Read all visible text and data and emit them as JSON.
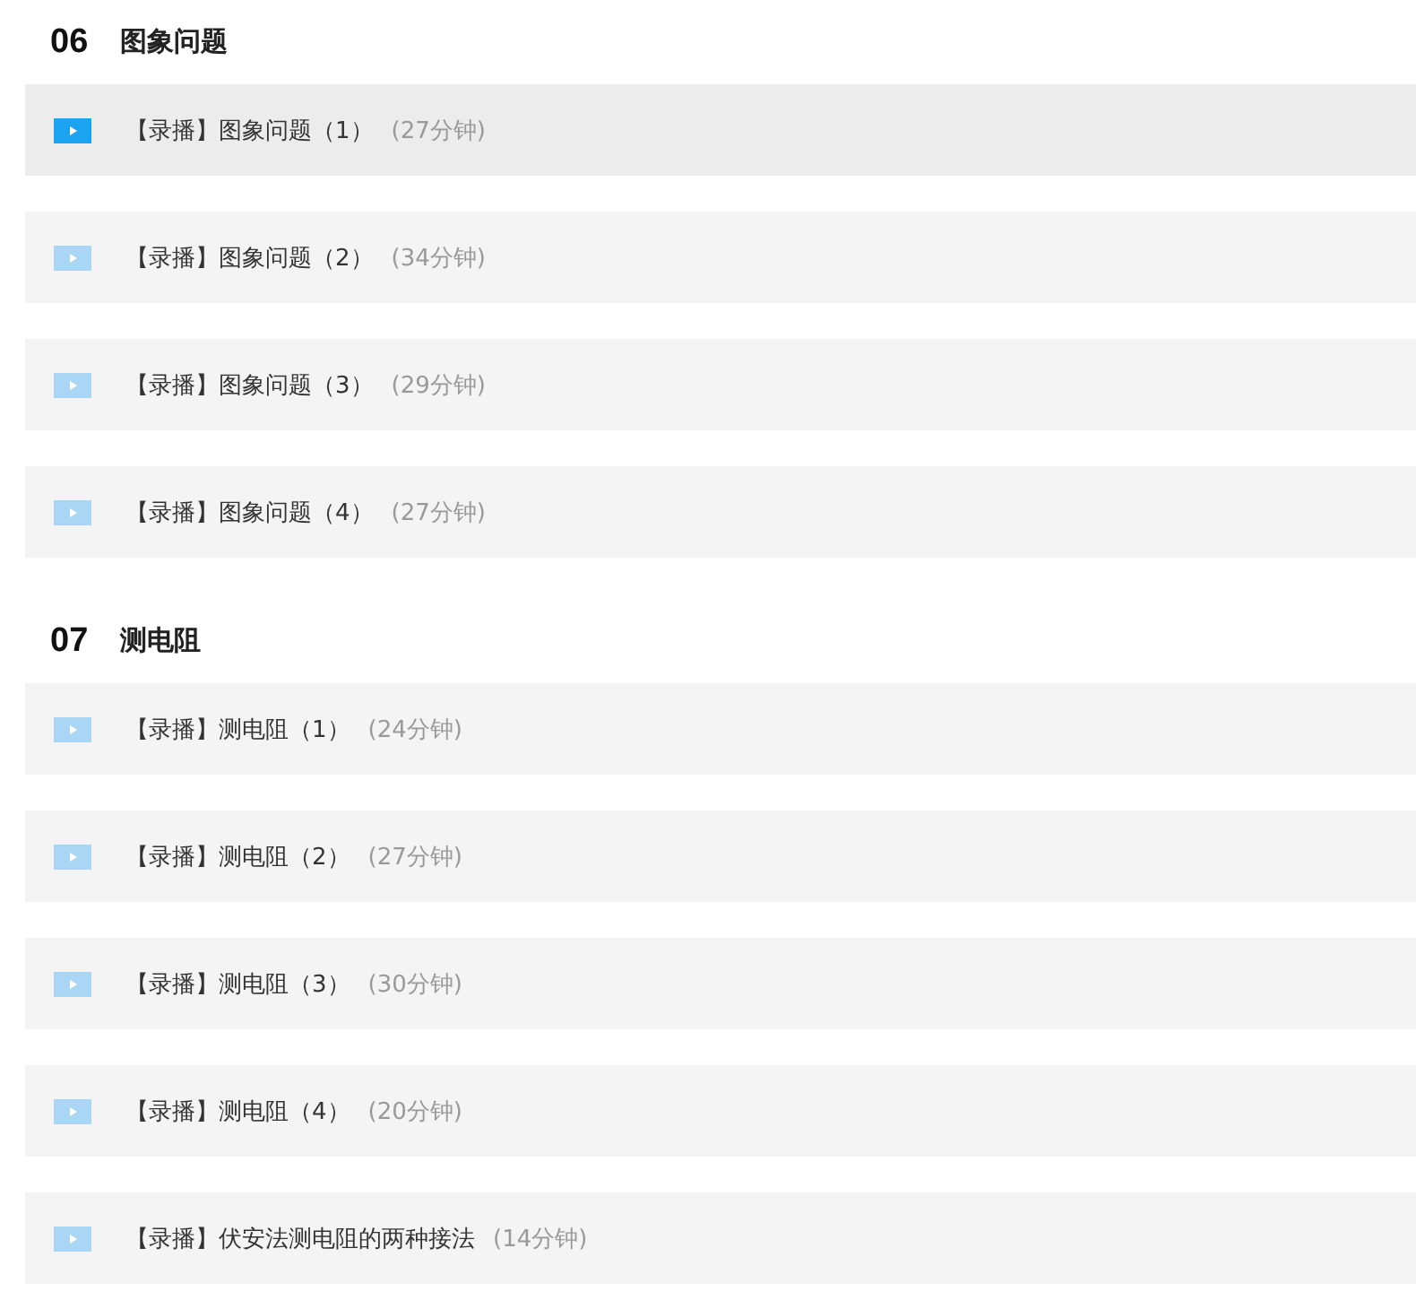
{
  "sections": [
    {
      "number": "06",
      "title": "图象问题",
      "lessons": [
        {
          "title": "【录播】图象问题（1）",
          "duration": "(27分钟)",
          "selected": true
        },
        {
          "title": "【录播】图象问题（2）",
          "duration": "(34分钟)",
          "selected": false
        },
        {
          "title": "【录播】图象问题（3）",
          "duration": "(29分钟)",
          "selected": false
        },
        {
          "title": "【录播】图象问题（4）",
          "duration": "(27分钟)",
          "selected": false
        }
      ]
    },
    {
      "number": "07",
      "title": "测电阻",
      "lessons": [
        {
          "title": "【录播】测电阻（1）",
          "duration": "(24分钟)",
          "selected": false
        },
        {
          "title": "【录播】测电阻（2）",
          "duration": "(27分钟)",
          "selected": false
        },
        {
          "title": "【录播】测电阻（3）",
          "duration": "(30分钟)",
          "selected": false
        },
        {
          "title": "【录播】测电阻（4）",
          "duration": "(20分钟)",
          "selected": false
        },
        {
          "title": "【录播】伏安法测电阻的两种接法",
          "duration": "(14分钟)",
          "selected": false
        }
      ]
    }
  ]
}
